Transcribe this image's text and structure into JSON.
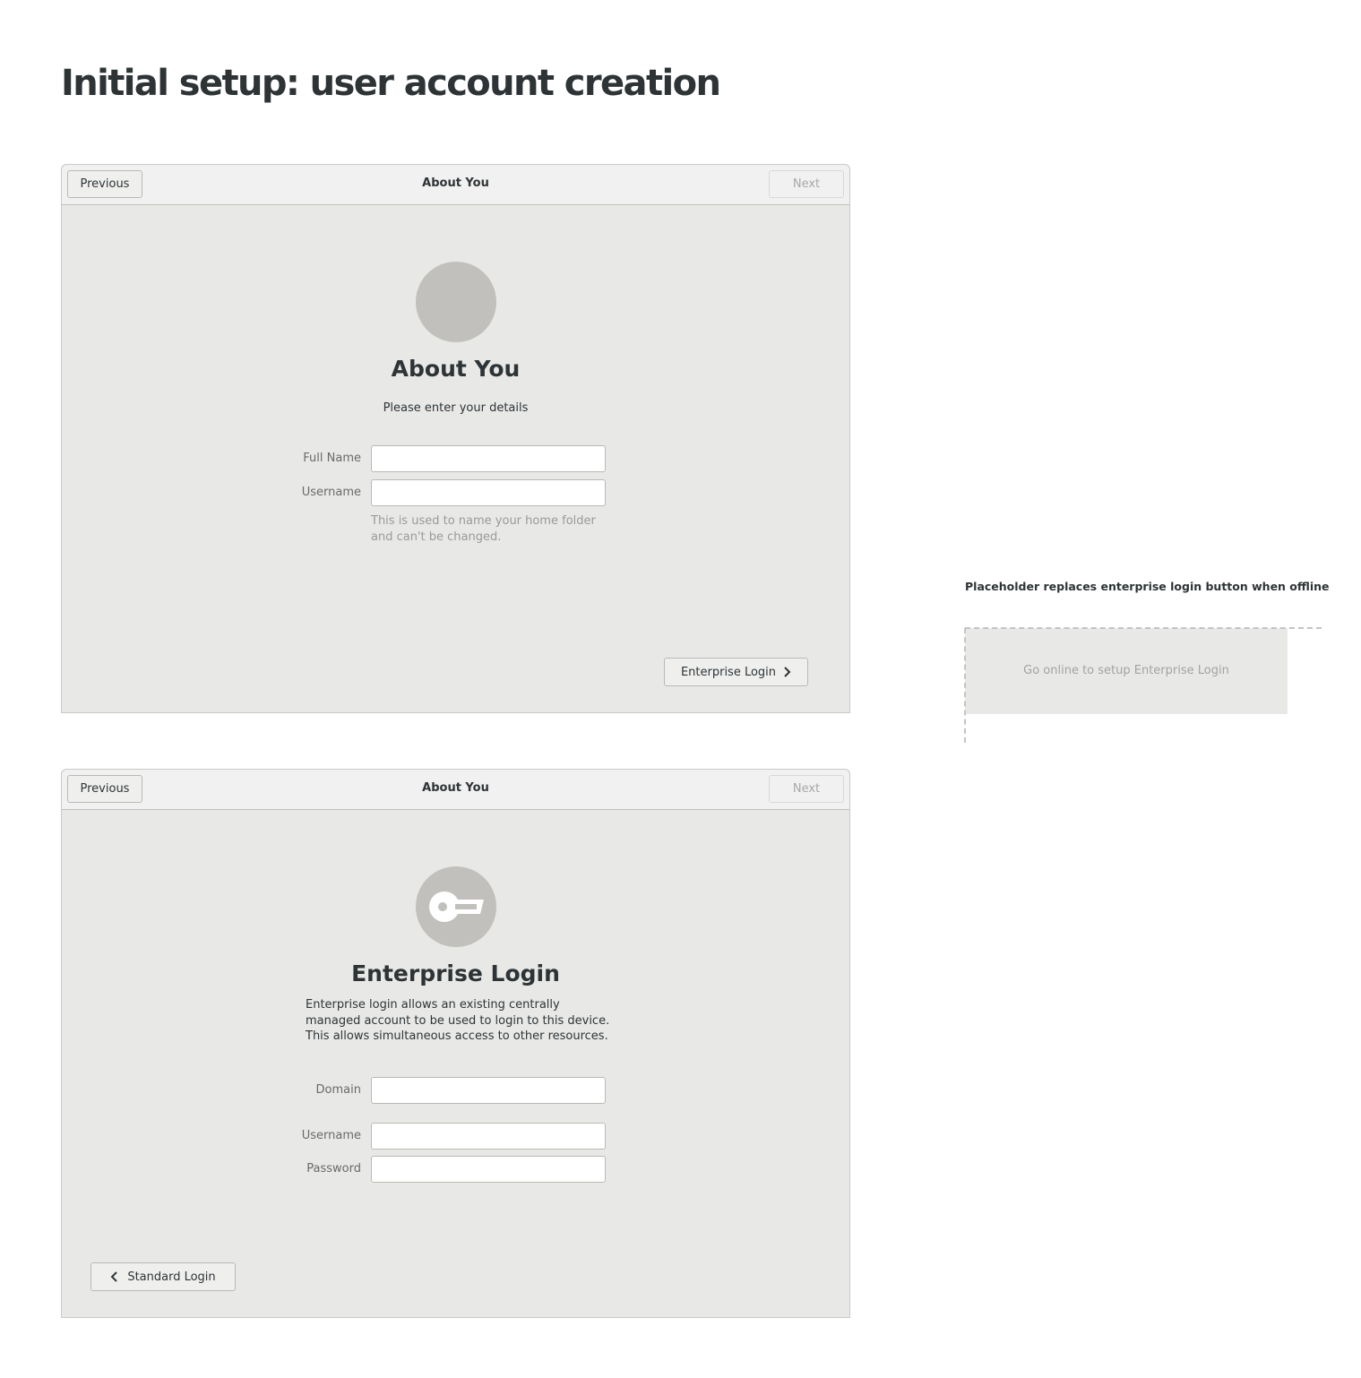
{
  "page": {
    "title": "Initial setup: user account creation"
  },
  "window1": {
    "header": {
      "previous_label": "Previous",
      "title": "About You",
      "next_label": "Next"
    },
    "heading": "About You",
    "subtitle": "Please enter your details",
    "fields": {
      "full_name_label": "Full Name",
      "username_label": "Username"
    },
    "username_hint": "This is used to name your home folder and can't be changed.",
    "enterprise_button_label": "Enterprise Login"
  },
  "window2": {
    "header": {
      "previous_label": "Previous",
      "title": "About You",
      "next_label": "Next"
    },
    "heading": "Enterprise Login",
    "description": "Enterprise login allows an existing centrally managed account to be used to login to this device. This allows simultaneous access to other resources.",
    "fields": {
      "domain_label": "Domain",
      "username_label": "Username",
      "password_label": "Password"
    },
    "standard_button_label": "Standard Login"
  },
  "annotation": {
    "label": "Placeholder replaces enterprise login button when offline",
    "placeholder_text": "Go online to setup Enterprise Login"
  },
  "colors": {
    "window_bg": "#e8e8e7",
    "header_bg": "#f1f1f1",
    "avatar": "#c2c0bc",
    "text": "#2e3436",
    "muted": "#a3a3a3"
  },
  "icons": {
    "enterprise_avatar": "key-icon",
    "enterprise_button": "chevron-right-icon",
    "standard_button": "chevron-left-icon"
  }
}
